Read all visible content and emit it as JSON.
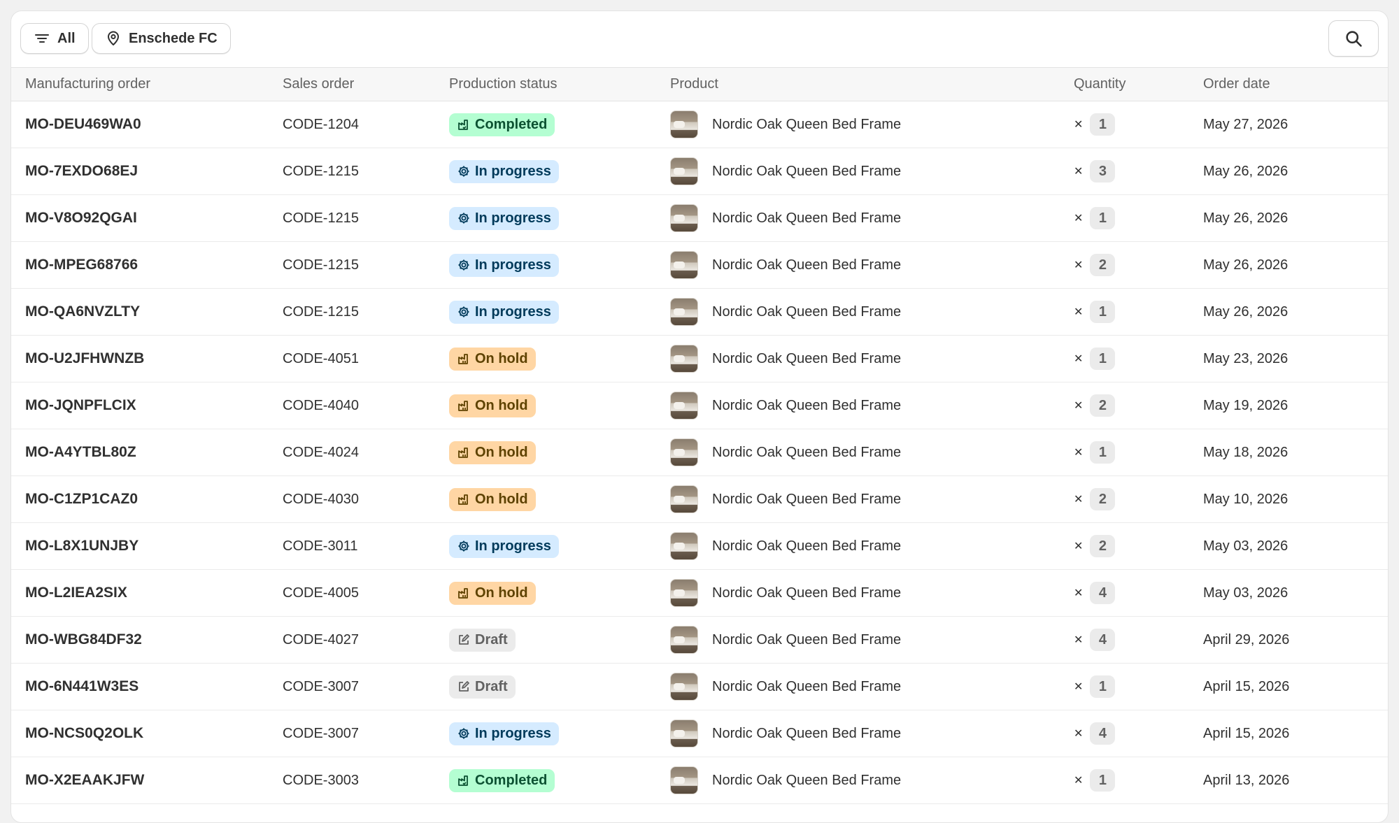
{
  "filters": {
    "all_label": "All",
    "location_label": "Enschede FC"
  },
  "columns": [
    "Manufacturing order",
    "Sales order",
    "Production status",
    "Product",
    "Quantity",
    "Order date"
  ],
  "status_colors": {
    "Completed": "#b4fed2",
    "In progress": "#d5ebff",
    "On hold": "#ffd6a4",
    "Draft": "#ebebeb"
  },
  "rows": [
    {
      "mo": "MO-DEU469WA0",
      "so": "CODE-1204",
      "status": "Completed",
      "product": "Nordic Oak Queen Bed Frame",
      "qty": "1",
      "date": "May 27, 2026"
    },
    {
      "mo": "MO-7EXDO68EJ",
      "so": "CODE-1215",
      "status": "In progress",
      "product": "Nordic Oak Queen Bed Frame",
      "qty": "3",
      "date": "May 26, 2026"
    },
    {
      "mo": "MO-V8O92QGAI",
      "so": "CODE-1215",
      "status": "In progress",
      "product": "Nordic Oak Queen Bed Frame",
      "qty": "1",
      "date": "May 26, 2026"
    },
    {
      "mo": "MO-MPEG68766",
      "so": "CODE-1215",
      "status": "In progress",
      "product": "Nordic Oak Queen Bed Frame",
      "qty": "2",
      "date": "May 26, 2026"
    },
    {
      "mo": "MO-QA6NVZLTY",
      "so": "CODE-1215",
      "status": "In progress",
      "product": "Nordic Oak Queen Bed Frame",
      "qty": "1",
      "date": "May 26, 2026"
    },
    {
      "mo": "MO-U2JFHWNZB",
      "so": "CODE-4051",
      "status": "On hold",
      "product": "Nordic Oak Queen Bed Frame",
      "qty": "1",
      "date": "May 23, 2026"
    },
    {
      "mo": "MO-JQNPFLCIX",
      "so": "CODE-4040",
      "status": "On hold",
      "product": "Nordic Oak Queen Bed Frame",
      "qty": "2",
      "date": "May 19, 2026"
    },
    {
      "mo": "MO-A4YTBL80Z",
      "so": "CODE-4024",
      "status": "On hold",
      "product": "Nordic Oak Queen Bed Frame",
      "qty": "1",
      "date": "May 18, 2026"
    },
    {
      "mo": "MO-C1ZP1CAZ0",
      "so": "CODE-4030",
      "status": "On hold",
      "product": "Nordic Oak Queen Bed Frame",
      "qty": "2",
      "date": "May 10, 2026"
    },
    {
      "mo": "MO-L8X1UNJBY",
      "so": "CODE-3011",
      "status": "In progress",
      "product": "Nordic Oak Queen Bed Frame",
      "qty": "2",
      "date": "May 03, 2026"
    },
    {
      "mo": "MO-L2IEA2SIX",
      "so": "CODE-4005",
      "status": "On hold",
      "product": "Nordic Oak Queen Bed Frame",
      "qty": "4",
      "date": "May 03, 2026"
    },
    {
      "mo": "MO-WBG84DF32",
      "so": "CODE-4027",
      "status": "Draft",
      "product": "Nordic Oak Queen Bed Frame",
      "qty": "4",
      "date": "April 29, 2026"
    },
    {
      "mo": "MO-6N441W3ES",
      "so": "CODE-3007",
      "status": "Draft",
      "product": "Nordic Oak Queen Bed Frame",
      "qty": "1",
      "date": "April 15, 2026"
    },
    {
      "mo": "MO-NCS0Q2OLK",
      "so": "CODE-3007",
      "status": "In progress",
      "product": "Nordic Oak Queen Bed Frame",
      "qty": "4",
      "date": "April 15, 2026"
    },
    {
      "mo": "MO-X2EAAKJFW",
      "so": "CODE-3003",
      "status": "Completed",
      "product": "Nordic Oak Queen Bed Frame",
      "qty": "1",
      "date": "April 13, 2026"
    }
  ]
}
